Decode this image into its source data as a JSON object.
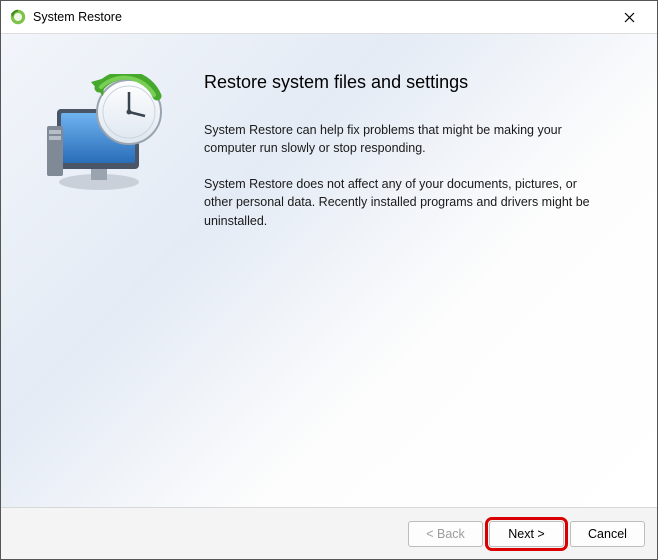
{
  "window": {
    "title": "System Restore"
  },
  "content": {
    "heading": "Restore system files and settings",
    "paragraph1": "System Restore can help fix problems that might be making your computer run slowly or stop responding.",
    "paragraph2": "System Restore does not affect any of your documents, pictures, or other personal data. Recently installed programs and drivers might be uninstalled."
  },
  "footer": {
    "back_label": "< Back",
    "next_label": "Next >",
    "cancel_label": "Cancel"
  }
}
